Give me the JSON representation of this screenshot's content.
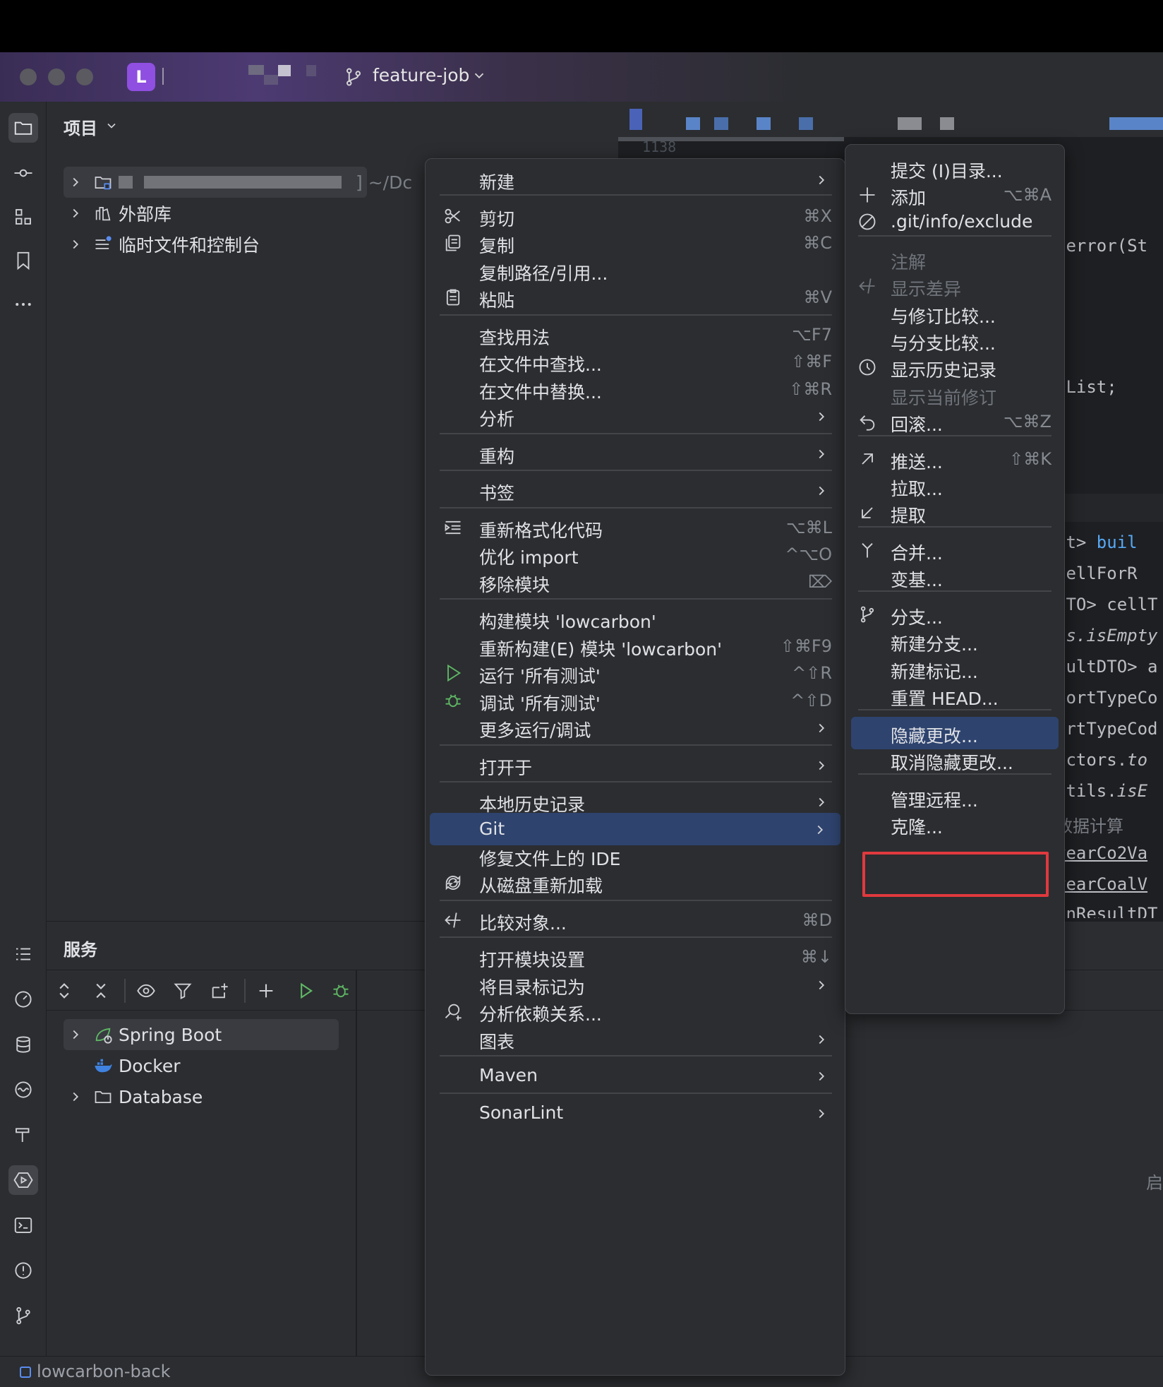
{
  "titlebar": {
    "project_initial": "L",
    "branch": "feature-job"
  },
  "project_panel": {
    "title": "项目",
    "root_suffix": "] ~/Dc",
    "items": [
      {
        "label": "外部库"
      },
      {
        "label": "临时文件和控制台"
      }
    ]
  },
  "editor": {
    "tab_num": "1138",
    "code": [
      {
        "text": "}"
      },
      {
        "text": "{"
      },
      {
        "text": ".error(St"
      },
      {
        "text": "tList;"
      },
      {
        "pre": "lt> ",
        "kw": "buil"
      },
      {
        "text": "cellForR"
      },
      {
        "text": "DTO> cellT"
      },
      {
        "pre": ".",
        "it": "s.isEmpty"
      },
      {
        "text": "sultDTO> a"
      },
      {
        "text": "portTypeCo"
      },
      {
        "text": "ortTypeCod"
      },
      {
        "pre": "ectors.",
        "it": "to"
      },
      {
        "pre": "Utils.",
        "it": "isE"
      },
      {
        "cm": "数据计算"
      },
      {
        "text": "yearCo2Va"
      },
      {
        "text": "yearCoalV"
      },
      {
        "text": "onResultDT"
      }
    ],
    "corner_char": "启"
  },
  "services": {
    "title": "服务",
    "items": [
      {
        "label": "Spring Boot"
      },
      {
        "label": "Docker"
      },
      {
        "label": "Database"
      }
    ]
  },
  "status_bar": {
    "project": "lowcarbon-back"
  },
  "context_menu": {
    "items": [
      {
        "label": "新建",
        "shortcut": ""
      },
      {
        "label": "剪切",
        "shortcut": "⌘X"
      },
      {
        "label": "复制",
        "shortcut": "⌘C"
      },
      {
        "label": "复制路径/引用...",
        "shortcut": ""
      },
      {
        "label": "粘贴",
        "shortcut": "⌘V"
      },
      {
        "label": "查找用法",
        "shortcut": "⌥F7"
      },
      {
        "label": "在文件中查找...",
        "shortcut": "⇧⌘F"
      },
      {
        "label": "在文件中替换...",
        "shortcut": "⇧⌘R"
      },
      {
        "label": "分析",
        "shortcut": ""
      },
      {
        "label": "重构",
        "shortcut": ""
      },
      {
        "label": "书签",
        "shortcut": ""
      },
      {
        "label": "重新格式化代码",
        "shortcut": "⌥⌘L"
      },
      {
        "label": "优化 import",
        "shortcut": "^⌥O"
      },
      {
        "label": "移除模块",
        "shortcut": "⌦"
      },
      {
        "label": "构建模块 'lowcarbon'",
        "shortcut": ""
      },
      {
        "label": "重新构建(E) 模块 'lowcarbon'",
        "shortcut": "⇧⌘F9"
      },
      {
        "label": "运行 '所有测试'",
        "shortcut": "^⇧R"
      },
      {
        "label": "调试 '所有测试'",
        "shortcut": "^⇧D"
      },
      {
        "label": "更多运行/调试",
        "shortcut": ""
      },
      {
        "label": "打开于",
        "shortcut": ""
      },
      {
        "label": "本地历史记录",
        "shortcut": ""
      },
      {
        "label": "Git",
        "shortcut": ""
      },
      {
        "label": "修复文件上的 IDE",
        "shortcut": ""
      },
      {
        "label": "从磁盘重新加载",
        "shortcut": ""
      },
      {
        "label": "比较对象...",
        "shortcut": "⌘D"
      },
      {
        "label": "打开模块设置",
        "shortcut": "⌘↓"
      },
      {
        "label": "将目录标记为",
        "shortcut": ""
      },
      {
        "label": "分析依赖关系...",
        "shortcut": ""
      },
      {
        "label": "图表",
        "shortcut": ""
      },
      {
        "label": "Maven",
        "shortcut": ""
      },
      {
        "label": "SonarLint",
        "shortcut": ""
      }
    ]
  },
  "git_menu": {
    "items": [
      {
        "label": "提交 (I)目录...",
        "shortcut": ""
      },
      {
        "label": "添加",
        "shortcut": "⌥⌘A"
      },
      {
        "label": ".git/info/exclude",
        "shortcut": ""
      },
      {
        "label": "注解",
        "shortcut": ""
      },
      {
        "label": "显示差异",
        "shortcut": ""
      },
      {
        "label": "与修订比较...",
        "shortcut": ""
      },
      {
        "label": "与分支比较...",
        "shortcut": ""
      },
      {
        "label": "显示历史记录",
        "shortcut": ""
      },
      {
        "label": "显示当前修订",
        "shortcut": ""
      },
      {
        "label": "回滚...",
        "shortcut": "⌥⌘Z"
      },
      {
        "label": "推送...",
        "shortcut": "⇧⌘K"
      },
      {
        "label": "拉取...",
        "shortcut": ""
      },
      {
        "label": "提取",
        "shortcut": ""
      },
      {
        "label": "合并...",
        "shortcut": ""
      },
      {
        "label": "变基...",
        "shortcut": ""
      },
      {
        "label": "分支...",
        "shortcut": ""
      },
      {
        "label": "新建分支...",
        "shortcut": ""
      },
      {
        "label": "新建标记...",
        "shortcut": ""
      },
      {
        "label": "重置 HEAD...",
        "shortcut": ""
      },
      {
        "label": "隐藏更改...",
        "shortcut": ""
      },
      {
        "label": "取消隐藏更改...",
        "shortcut": ""
      },
      {
        "label": "管理远程...",
        "shortcut": ""
      },
      {
        "label": "克隆...",
        "shortcut": ""
      }
    ]
  },
  "colors": {
    "accent_selection": "#2e436e",
    "highlight_box": "#e0393e",
    "badge": "#8f4fe0"
  }
}
